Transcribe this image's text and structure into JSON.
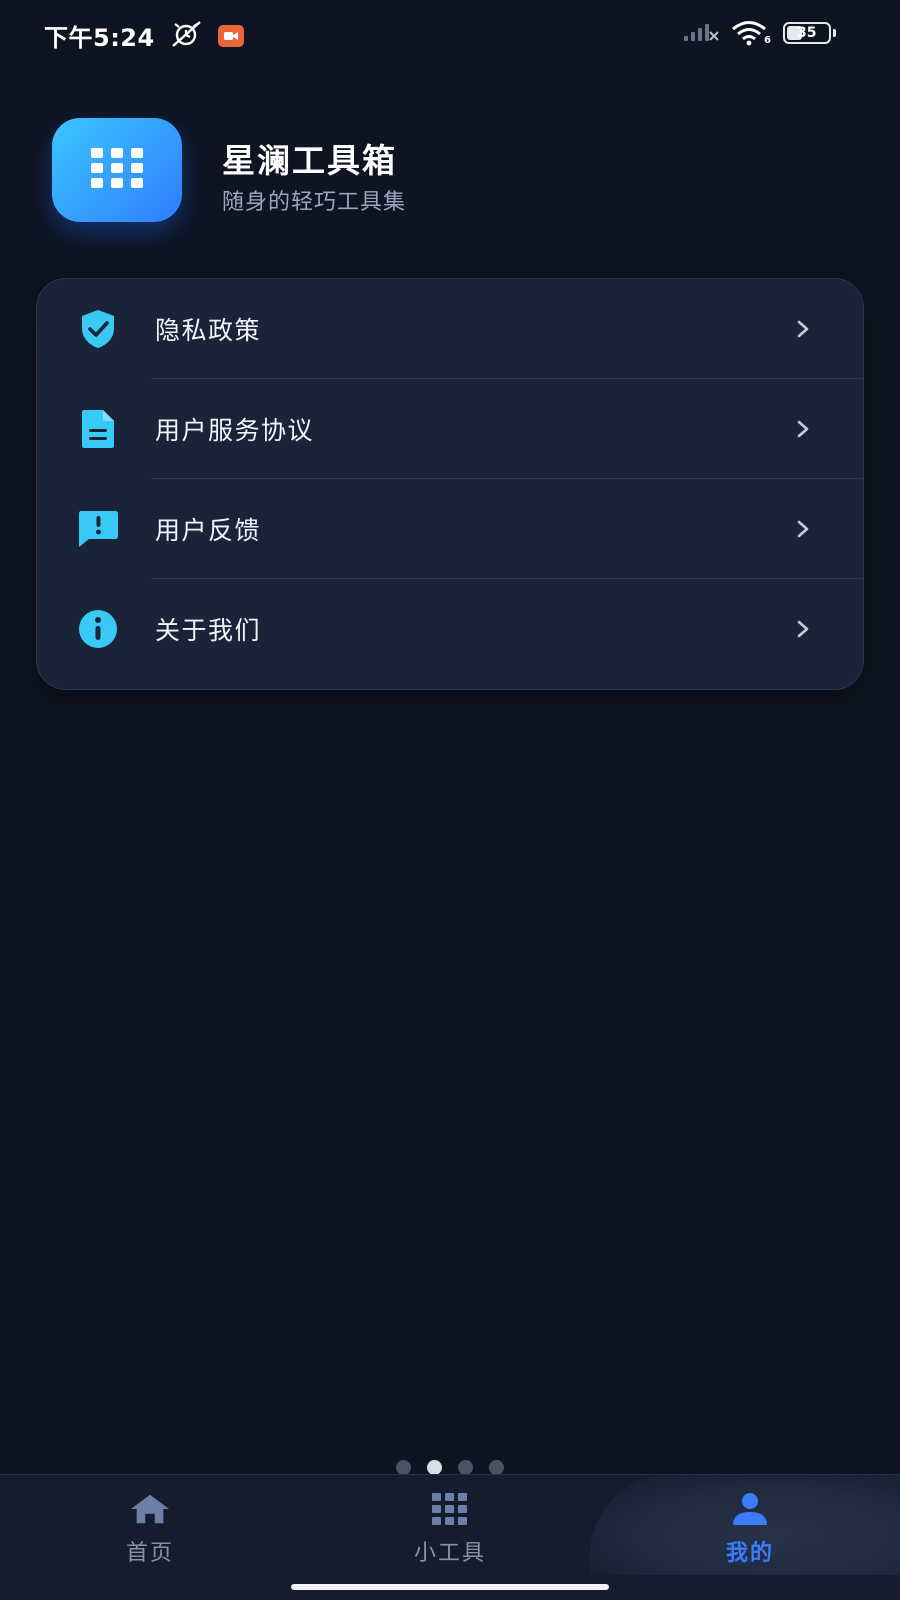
{
  "status_bar": {
    "time": "下午5:24",
    "battery_level": "35",
    "network_label": "6"
  },
  "header": {
    "title": "星澜工具箱",
    "subtitle": "随身的轻巧工具集",
    "logo_icon": "grid-icon"
  },
  "menu": {
    "items": [
      {
        "label": "隐私政策",
        "icon": "shield-check-icon"
      },
      {
        "label": "用户服务协议",
        "icon": "document-icon"
      },
      {
        "label": "用户反馈",
        "icon": "feedback-chat-icon"
      },
      {
        "label": "关于我们",
        "icon": "info-icon"
      }
    ]
  },
  "page_indicator": {
    "count": 4,
    "active_index": 1
  },
  "tab_bar": {
    "tabs": [
      {
        "label": "首页",
        "icon": "home-icon"
      },
      {
        "label": "小工具",
        "icon": "grid-icon"
      },
      {
        "label": "我的",
        "icon": "person-icon"
      }
    ],
    "active_index": 2
  },
  "colors": {
    "background": "#0e1422",
    "card": "#1a2438",
    "accent_cyan": "#38c9f5",
    "accent_blue": "#3b7cff",
    "inactive_tab": "#8a93a6"
  }
}
